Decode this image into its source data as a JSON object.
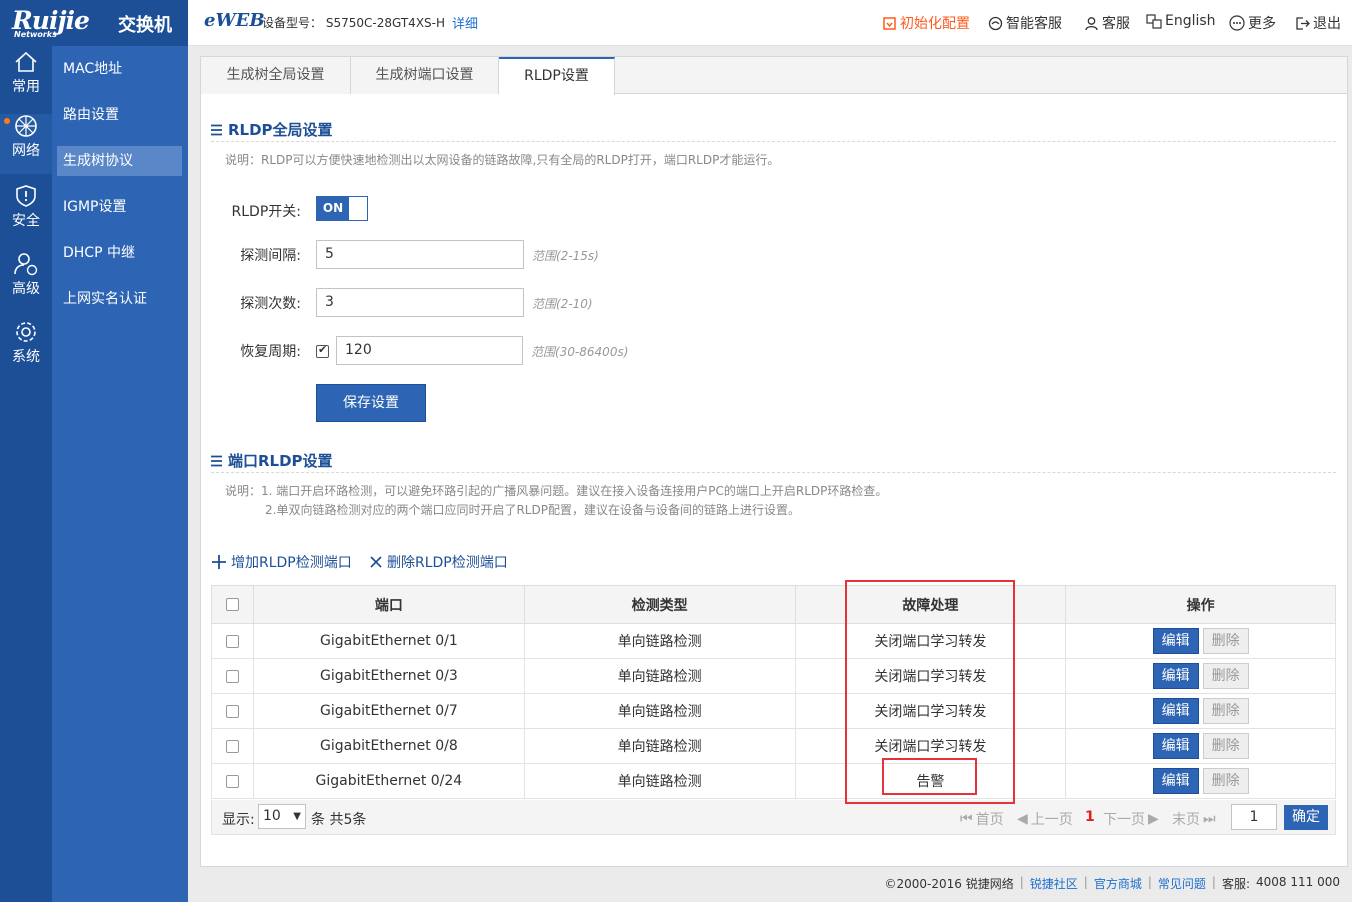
{
  "brand": {
    "logo": "Ruijie",
    "logo_sub": "Networks",
    "product": "交换机"
  },
  "rail": [
    {
      "label": "常用",
      "icon": "home-icon"
    },
    {
      "label": "网络",
      "icon": "network-icon"
    },
    {
      "label": "安全",
      "icon": "shield-icon"
    },
    {
      "label": "高级",
      "icon": "user-settings-icon"
    },
    {
      "label": "系统",
      "icon": "gear-icon"
    }
  ],
  "subnav": [
    "MAC地址",
    "路由设置",
    "生成树协议",
    "IGMP设置",
    "DHCP 中继",
    "上网实名认证"
  ],
  "header": {
    "eweb": "eWEB",
    "model_label": "设备型号：",
    "model_value": "S5750C-28GT4XS-H",
    "detail": "详细",
    "actions": [
      "初始化配置",
      "智能客服",
      "客服",
      "English",
      "更多",
      "退出"
    ]
  },
  "tabs": [
    "生成树全局设置",
    "生成树端口设置",
    "RLDP设置"
  ],
  "global": {
    "title": "RLDP全局设置",
    "desc": "说明：RLDP可以方便快速地检测出以太网设备的链路故障,只有全局的RLDP打开，端口RLDP才能运行。",
    "switch_label": "RLDP开关:",
    "switch_state": "ON",
    "interval_label": "探测间隔:",
    "interval_value": "5",
    "interval_range": "范围(2-15s)",
    "count_label": "探测次数:",
    "count_value": "3",
    "count_range": "范围(2-10)",
    "recover_label": "恢复周期:",
    "recover_value": "120",
    "recover_range": "范围(30-86400s)",
    "save": "保存设置"
  },
  "port": {
    "title": "端口RLDP设置",
    "desc1": "说明：1. 端口开启环路检测，可以避免环路引起的广播风暴问题。建议在接入设备连接用户PC的端口上开启RLDP环路检查。",
    "desc2": "2.单双向链路检测对应的两个端口应同时开启了RLDP配置，建议在设备与设备间的链路上进行设置。",
    "add": "增加RLDP检测端口",
    "remove": "删除RLDP检测端口",
    "columns": [
      "端口",
      "检测类型",
      "故障处理",
      "操作"
    ],
    "rows": [
      {
        "port": "GigabitEthernet 0/1",
        "type": "单向链路检测",
        "action": "关闭端口学习转发"
      },
      {
        "port": "GigabitEthernet 0/3",
        "type": "单向链路检测",
        "action": "关闭端口学习转发"
      },
      {
        "port": "GigabitEthernet 0/7",
        "type": "单向链路检测",
        "action": "关闭端口学习转发"
      },
      {
        "port": "GigabitEthernet 0/8",
        "type": "单向链路检测",
        "action": "关闭端口学习转发"
      },
      {
        "port": "GigabitEthernet 0/24",
        "type": "单向链路检测",
        "action": "告警"
      }
    ],
    "edit": "编辑",
    "delete": "删除"
  },
  "pager": {
    "show": "显示:",
    "page_size": "10",
    "total": "条 共5条",
    "first": "首页",
    "prev": "上一页",
    "current": "1",
    "next": "下一页",
    "last": "末页",
    "goto_value": "1",
    "confirm": "确定"
  },
  "footer": {
    "copyright": "©2000-2016 锐捷网络",
    "community": "锐捷社区",
    "store": "官方商城",
    "faq": "常见问题",
    "hotline_label": "客服:",
    "hotline": "4008 111 000"
  },
  "colors": {
    "nav_dark": "#1d4f97",
    "nav_mid": "#2d64b3",
    "accent_orange": "#ff5a1a",
    "highlight_red": "#e5323b"
  }
}
